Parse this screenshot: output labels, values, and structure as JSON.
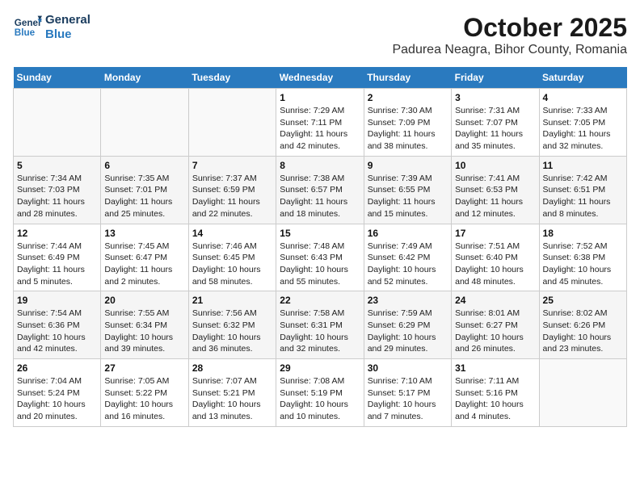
{
  "header": {
    "logo_line1": "General",
    "logo_line2": "Blue",
    "title": "October 2025",
    "subtitle": "Padurea Neagra, Bihor County, Romania"
  },
  "weekdays": [
    "Sunday",
    "Monday",
    "Tuesday",
    "Wednesday",
    "Thursday",
    "Friday",
    "Saturday"
  ],
  "weeks": [
    [
      {
        "day": "",
        "info": ""
      },
      {
        "day": "",
        "info": ""
      },
      {
        "day": "",
        "info": ""
      },
      {
        "day": "1",
        "info": "Sunrise: 7:29 AM\nSunset: 7:11 PM\nDaylight: 11 hours\nand 42 minutes."
      },
      {
        "day": "2",
        "info": "Sunrise: 7:30 AM\nSunset: 7:09 PM\nDaylight: 11 hours\nand 38 minutes."
      },
      {
        "day": "3",
        "info": "Sunrise: 7:31 AM\nSunset: 7:07 PM\nDaylight: 11 hours\nand 35 minutes."
      },
      {
        "day": "4",
        "info": "Sunrise: 7:33 AM\nSunset: 7:05 PM\nDaylight: 11 hours\nand 32 minutes."
      }
    ],
    [
      {
        "day": "5",
        "info": "Sunrise: 7:34 AM\nSunset: 7:03 PM\nDaylight: 11 hours\nand 28 minutes."
      },
      {
        "day": "6",
        "info": "Sunrise: 7:35 AM\nSunset: 7:01 PM\nDaylight: 11 hours\nand 25 minutes."
      },
      {
        "day": "7",
        "info": "Sunrise: 7:37 AM\nSunset: 6:59 PM\nDaylight: 11 hours\nand 22 minutes."
      },
      {
        "day": "8",
        "info": "Sunrise: 7:38 AM\nSunset: 6:57 PM\nDaylight: 11 hours\nand 18 minutes."
      },
      {
        "day": "9",
        "info": "Sunrise: 7:39 AM\nSunset: 6:55 PM\nDaylight: 11 hours\nand 15 minutes."
      },
      {
        "day": "10",
        "info": "Sunrise: 7:41 AM\nSunset: 6:53 PM\nDaylight: 11 hours\nand 12 minutes."
      },
      {
        "day": "11",
        "info": "Sunrise: 7:42 AM\nSunset: 6:51 PM\nDaylight: 11 hours\nand 8 minutes."
      }
    ],
    [
      {
        "day": "12",
        "info": "Sunrise: 7:44 AM\nSunset: 6:49 PM\nDaylight: 11 hours\nand 5 minutes."
      },
      {
        "day": "13",
        "info": "Sunrise: 7:45 AM\nSunset: 6:47 PM\nDaylight: 11 hours\nand 2 minutes."
      },
      {
        "day": "14",
        "info": "Sunrise: 7:46 AM\nSunset: 6:45 PM\nDaylight: 10 hours\nand 58 minutes."
      },
      {
        "day": "15",
        "info": "Sunrise: 7:48 AM\nSunset: 6:43 PM\nDaylight: 10 hours\nand 55 minutes."
      },
      {
        "day": "16",
        "info": "Sunrise: 7:49 AM\nSunset: 6:42 PM\nDaylight: 10 hours\nand 52 minutes."
      },
      {
        "day": "17",
        "info": "Sunrise: 7:51 AM\nSunset: 6:40 PM\nDaylight: 10 hours\nand 48 minutes."
      },
      {
        "day": "18",
        "info": "Sunrise: 7:52 AM\nSunset: 6:38 PM\nDaylight: 10 hours\nand 45 minutes."
      }
    ],
    [
      {
        "day": "19",
        "info": "Sunrise: 7:54 AM\nSunset: 6:36 PM\nDaylight: 10 hours\nand 42 minutes."
      },
      {
        "day": "20",
        "info": "Sunrise: 7:55 AM\nSunset: 6:34 PM\nDaylight: 10 hours\nand 39 minutes."
      },
      {
        "day": "21",
        "info": "Sunrise: 7:56 AM\nSunset: 6:32 PM\nDaylight: 10 hours\nand 36 minutes."
      },
      {
        "day": "22",
        "info": "Sunrise: 7:58 AM\nSunset: 6:31 PM\nDaylight: 10 hours\nand 32 minutes."
      },
      {
        "day": "23",
        "info": "Sunrise: 7:59 AM\nSunset: 6:29 PM\nDaylight: 10 hours\nand 29 minutes."
      },
      {
        "day": "24",
        "info": "Sunrise: 8:01 AM\nSunset: 6:27 PM\nDaylight: 10 hours\nand 26 minutes."
      },
      {
        "day": "25",
        "info": "Sunrise: 8:02 AM\nSunset: 6:26 PM\nDaylight: 10 hours\nand 23 minutes."
      }
    ],
    [
      {
        "day": "26",
        "info": "Sunrise: 7:04 AM\nSunset: 5:24 PM\nDaylight: 10 hours\nand 20 minutes."
      },
      {
        "day": "27",
        "info": "Sunrise: 7:05 AM\nSunset: 5:22 PM\nDaylight: 10 hours\nand 16 minutes."
      },
      {
        "day": "28",
        "info": "Sunrise: 7:07 AM\nSunset: 5:21 PM\nDaylight: 10 hours\nand 13 minutes."
      },
      {
        "day": "29",
        "info": "Sunrise: 7:08 AM\nSunset: 5:19 PM\nDaylight: 10 hours\nand 10 minutes."
      },
      {
        "day": "30",
        "info": "Sunrise: 7:10 AM\nSunset: 5:17 PM\nDaylight: 10 hours\nand 7 minutes."
      },
      {
        "day": "31",
        "info": "Sunrise: 7:11 AM\nSunset: 5:16 PM\nDaylight: 10 hours\nand 4 minutes."
      },
      {
        "day": "",
        "info": ""
      }
    ]
  ]
}
